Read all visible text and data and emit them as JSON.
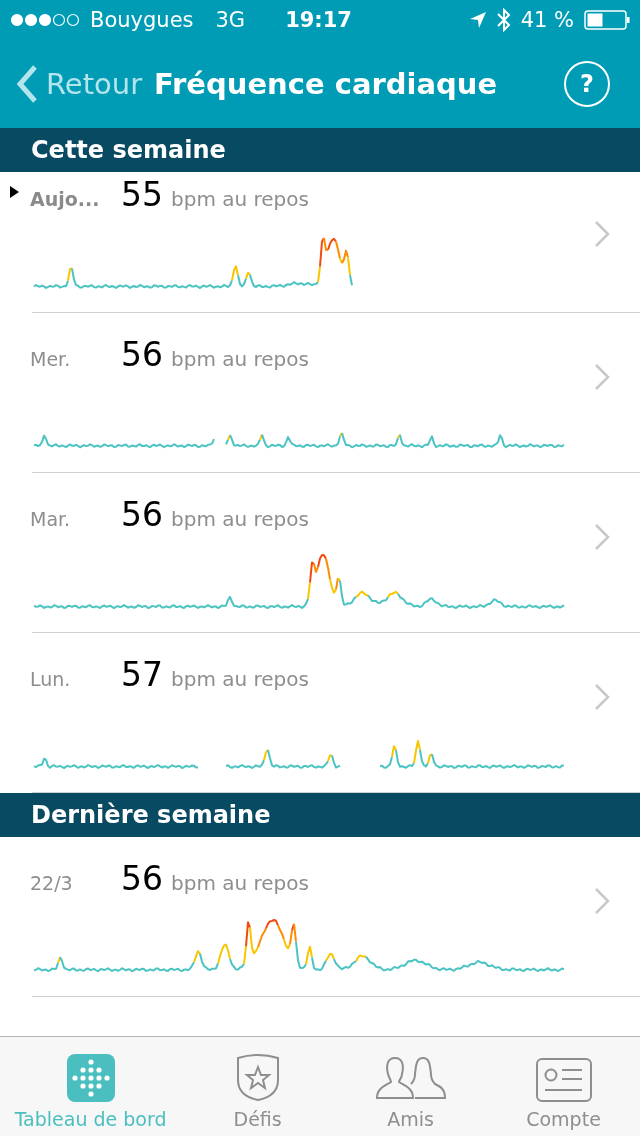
{
  "status_bar": {
    "carrier": "Bouygues",
    "network": "3G",
    "time": "19:17",
    "battery": "41 %"
  },
  "nav": {
    "back": "Retour",
    "title": "Fréquence cardiaque",
    "help": "?"
  },
  "sections": [
    {
      "title": "Cette semaine",
      "days": [
        {
          "label": "Aujo...",
          "selected": true,
          "bpm": "55",
          "unit": "bpm au repos"
        },
        {
          "label": "Mer.",
          "selected": false,
          "bpm": "56",
          "unit": "bpm au repos"
        },
        {
          "label": "Mar.",
          "selected": false,
          "bpm": "56",
          "unit": "bpm au repos"
        },
        {
          "label": "Lun.",
          "selected": false,
          "bpm": "57",
          "unit": "bpm au repos"
        }
      ]
    },
    {
      "title": "Dernière semaine",
      "days": [
        {
          "label": "22/3",
          "selected": false,
          "bpm": "56",
          "unit": "bpm au repos"
        }
      ]
    }
  ],
  "tabs": [
    {
      "label": "Tableau de bord",
      "selected": true
    },
    {
      "label": "Défis",
      "selected": false
    },
    {
      "label": "Amis",
      "selected": false
    },
    {
      "label": "Compte",
      "selected": false
    }
  ]
}
